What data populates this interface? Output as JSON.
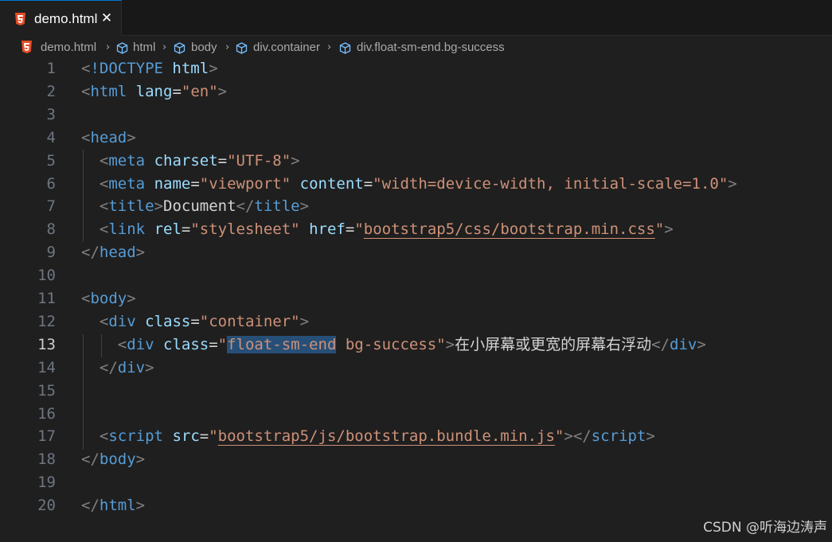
{
  "tab": {
    "title": "demo.html",
    "close_glyph": "✕",
    "icon": "html5-icon"
  },
  "breadcrumb": {
    "items": [
      "demo.html",
      "html",
      "body",
      "div.container",
      "div.float-sm-end.bg-success"
    ],
    "separator": "›"
  },
  "editor": {
    "active_line": 13,
    "line_numbers": [
      "1",
      "2",
      "3",
      "4",
      "5",
      "6",
      "7",
      "8",
      "9",
      "10",
      "11",
      "12",
      "13",
      "14",
      "15",
      "16",
      "17",
      "18",
      "19",
      "20"
    ],
    "lines": [
      [
        [
          "p",
          "<"
        ],
        [
          "t",
          "!DOCTYPE"
        ],
        [
          "x",
          " "
        ],
        [
          "a",
          "html"
        ],
        [
          "p",
          ">"
        ]
      ],
      [
        [
          "p",
          "<"
        ],
        [
          "t",
          "html"
        ],
        [
          "x",
          " "
        ],
        [
          "a",
          "lang"
        ],
        [
          "x",
          "="
        ],
        [
          "s",
          "\"en\""
        ],
        [
          "p",
          ">"
        ]
      ],
      [],
      [
        [
          "p",
          "<"
        ],
        [
          "t",
          "head"
        ],
        [
          "p",
          ">"
        ]
      ],
      [
        [
          "x",
          "  "
        ],
        [
          "p",
          "<"
        ],
        [
          "t",
          "meta"
        ],
        [
          "x",
          " "
        ],
        [
          "a",
          "charset"
        ],
        [
          "x",
          "="
        ],
        [
          "s",
          "\"UTF-8\""
        ],
        [
          "p",
          ">"
        ]
      ],
      [
        [
          "x",
          "  "
        ],
        [
          "p",
          "<"
        ],
        [
          "t",
          "meta"
        ],
        [
          "x",
          " "
        ],
        [
          "a",
          "name"
        ],
        [
          "x",
          "="
        ],
        [
          "s",
          "\"viewport\""
        ],
        [
          "x",
          " "
        ],
        [
          "a",
          "content"
        ],
        [
          "x",
          "="
        ],
        [
          "s",
          "\"width=device-width, initial-scale=1.0\""
        ],
        [
          "p",
          ">"
        ]
      ],
      [
        [
          "x",
          "  "
        ],
        [
          "p",
          "<"
        ],
        [
          "t",
          "title"
        ],
        [
          "p",
          ">"
        ],
        [
          "x",
          "Document"
        ],
        [
          "p",
          "</"
        ],
        [
          "t",
          "title"
        ],
        [
          "p",
          ">"
        ]
      ],
      [
        [
          "x",
          "  "
        ],
        [
          "p",
          "<"
        ],
        [
          "t",
          "link"
        ],
        [
          "x",
          " "
        ],
        [
          "a",
          "rel"
        ],
        [
          "x",
          "="
        ],
        [
          "s",
          "\"stylesheet\""
        ],
        [
          "x",
          " "
        ],
        [
          "a",
          "href"
        ],
        [
          "x",
          "="
        ],
        [
          "s",
          "\""
        ],
        [
          "su",
          "bootstrap5/css/bootstrap.min.css"
        ],
        [
          "s",
          "\""
        ],
        [
          "p",
          ">"
        ]
      ],
      [
        [
          "p",
          "</"
        ],
        [
          "t",
          "head"
        ],
        [
          "p",
          ">"
        ]
      ],
      [],
      [
        [
          "p",
          "<"
        ],
        [
          "t",
          "body"
        ],
        [
          "p",
          ">"
        ]
      ],
      [
        [
          "x",
          "  "
        ],
        [
          "p",
          "<"
        ],
        [
          "t",
          "div"
        ],
        [
          "x",
          " "
        ],
        [
          "a",
          "class"
        ],
        [
          "x",
          "="
        ],
        [
          "s",
          "\"container\""
        ],
        [
          "p",
          ">"
        ]
      ],
      [
        [
          "x",
          "    "
        ],
        [
          "p",
          "<"
        ],
        [
          "t",
          "div"
        ],
        [
          "x",
          " "
        ],
        [
          "a",
          "class"
        ],
        [
          "x",
          "="
        ],
        [
          "s",
          "\""
        ],
        [
          "ssel",
          "float-sm-end"
        ],
        [
          "s",
          " bg-success\""
        ],
        [
          "p",
          ">"
        ],
        [
          "xc",
          "在小屏幕或更宽的屏幕右浮动"
        ],
        [
          "p",
          "</"
        ],
        [
          "t",
          "div"
        ],
        [
          "p",
          ">"
        ]
      ],
      [
        [
          "x",
          "  "
        ],
        [
          "p",
          "</"
        ],
        [
          "t",
          "div"
        ],
        [
          "p",
          ">"
        ]
      ],
      [],
      [],
      [
        [
          "x",
          "  "
        ],
        [
          "p",
          "<"
        ],
        [
          "t",
          "script"
        ],
        [
          "x",
          " "
        ],
        [
          "a",
          "src"
        ],
        [
          "x",
          "="
        ],
        [
          "s",
          "\""
        ],
        [
          "su",
          "bootstrap5/js/bootstrap.bundle.min.js"
        ],
        [
          "s",
          "\""
        ],
        [
          "p",
          "></"
        ],
        [
          "t",
          "script"
        ],
        [
          "p",
          ">"
        ]
      ],
      [
        [
          "p",
          "</"
        ],
        [
          "t",
          "body"
        ],
        [
          "p",
          ">"
        ]
      ],
      [],
      [
        [
          "p",
          "</"
        ],
        [
          "t",
          "html"
        ],
        [
          "p",
          ">"
        ]
      ]
    ]
  },
  "watermark": "CSDN @听海边涛声",
  "colors": {
    "tag": "#569cd6",
    "attribute": "#9cdcfe",
    "string": "#ce9178",
    "punctuation": "#808080",
    "text": "#d4d4d4",
    "selection": "#264f78",
    "accent": "#0078d4",
    "html5_icon": "#e44d26"
  }
}
